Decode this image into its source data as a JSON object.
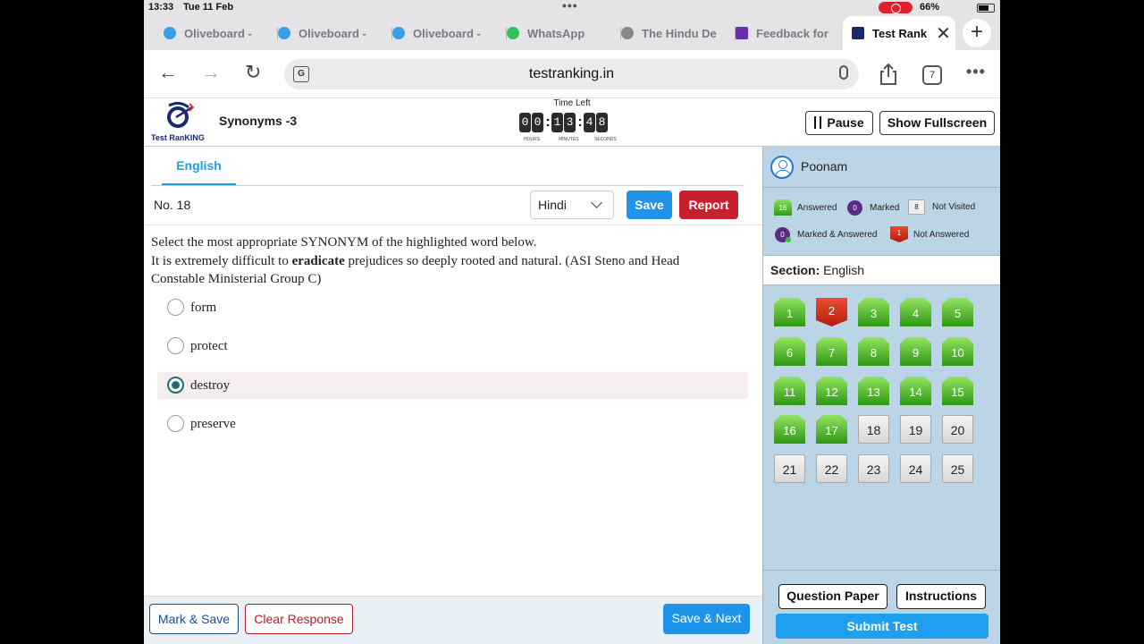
{
  "status_bar": {
    "time": "13:33",
    "date": "Tue 11 Feb",
    "battery": "66%"
  },
  "browser_tabs": [
    {
      "label": "Oliveboard -",
      "icon": "oliveboard-icon",
      "color": "#3aa0e6"
    },
    {
      "label": "Oliveboard -",
      "icon": "oliveboard-icon",
      "color": "#3aa0e6"
    },
    {
      "label": "Oliveboard -",
      "icon": "oliveboard-icon",
      "color": "#3aa0e6"
    },
    {
      "label": "WhatsApp",
      "icon": "whatsapp-icon",
      "color": "#35c15a"
    },
    {
      "label": "The Hindu De",
      "icon": "globe-icon",
      "color": "#888888"
    },
    {
      "label": "Feedback for",
      "icon": "form-icon",
      "color": "#6a2fb0"
    },
    {
      "label": "Test Rank",
      "icon": "testranking-icon",
      "color": "#1a2a6c",
      "active": true
    }
  ],
  "new_tab": "+",
  "toolbar": {
    "url": "testranking.in",
    "tab_count": "7"
  },
  "app": {
    "logo_text": "Test RanKING",
    "test_name": "Synonyms -3",
    "timer": {
      "label": "Time Left",
      "digits": [
        "0",
        "0",
        "1",
        "3",
        "4",
        "8"
      ],
      "units": [
        "HOURS",
        "MINUTES",
        "SECONDS"
      ]
    },
    "pause_label": "Pause",
    "fullscreen_label": "Show Fullscreen"
  },
  "main": {
    "language_tab": "English",
    "question_number": "No. 18",
    "language_select": "Hindi",
    "save_label": "Save",
    "report_label": "Report",
    "question_line1": "Select the most appropriate SYNONYM of the highlighted word below.",
    "question_pre": "It is extremely difficult to ",
    "question_bold": "eradicate",
    "question_post": " prejudices so deeply rooted and natural. (ASI Steno and Head Constable Ministerial Group C)",
    "options": [
      {
        "text": "form",
        "selected": false
      },
      {
        "text": "protect",
        "selected": false
      },
      {
        "text": "destroy",
        "selected": true
      },
      {
        "text": "preserve",
        "selected": false
      }
    ],
    "footer": {
      "mark_save": "Mark & Save",
      "clear_response": "Clear Response",
      "save_next": "Save & Next"
    }
  },
  "side": {
    "user_name": "Poonam",
    "legend": {
      "answered_count": "16",
      "answered_label": "Answered",
      "marked_count": "0",
      "marked_label": "Marked",
      "not_visited_count": "8",
      "not_visited_label": "Not Visited",
      "marked_answered_count": "0",
      "marked_answered_label": "Marked & Answered",
      "not_answered_count": "1",
      "not_answered_label": "Not Answered"
    },
    "section_label": "Section:",
    "section_value": "English",
    "questions": [
      {
        "n": "1",
        "s": "ans"
      },
      {
        "n": "2",
        "s": "na"
      },
      {
        "n": "3",
        "s": "ans"
      },
      {
        "n": "4",
        "s": "ans"
      },
      {
        "n": "5",
        "s": "ans"
      },
      {
        "n": "6",
        "s": "ans"
      },
      {
        "n": "7",
        "s": "ans"
      },
      {
        "n": "8",
        "s": "ans"
      },
      {
        "n": "9",
        "s": "ans"
      },
      {
        "n": "10",
        "s": "ans"
      },
      {
        "n": "11",
        "s": "ans"
      },
      {
        "n": "12",
        "s": "ans"
      },
      {
        "n": "13",
        "s": "ans"
      },
      {
        "n": "14",
        "s": "ans"
      },
      {
        "n": "15",
        "s": "ans"
      },
      {
        "n": "16",
        "s": "ans"
      },
      {
        "n": "17",
        "s": "ans"
      },
      {
        "n": "18",
        "s": "nv"
      },
      {
        "n": "19",
        "s": "nv"
      },
      {
        "n": "20",
        "s": "nv"
      },
      {
        "n": "21",
        "s": "nv"
      },
      {
        "n": "22",
        "s": "nv"
      },
      {
        "n": "23",
        "s": "nv"
      },
      {
        "n": "24",
        "s": "nv"
      },
      {
        "n": "25",
        "s": "nv"
      }
    ],
    "question_paper": "Question Paper",
    "instructions": "Instructions",
    "submit": "Submit Test"
  },
  "colors": {
    "accent": "#1e93e8",
    "report": "#c8202d",
    "panel": "#bcd5e6",
    "answered": "#3fae1c",
    "not_answered": "#c8271a"
  }
}
